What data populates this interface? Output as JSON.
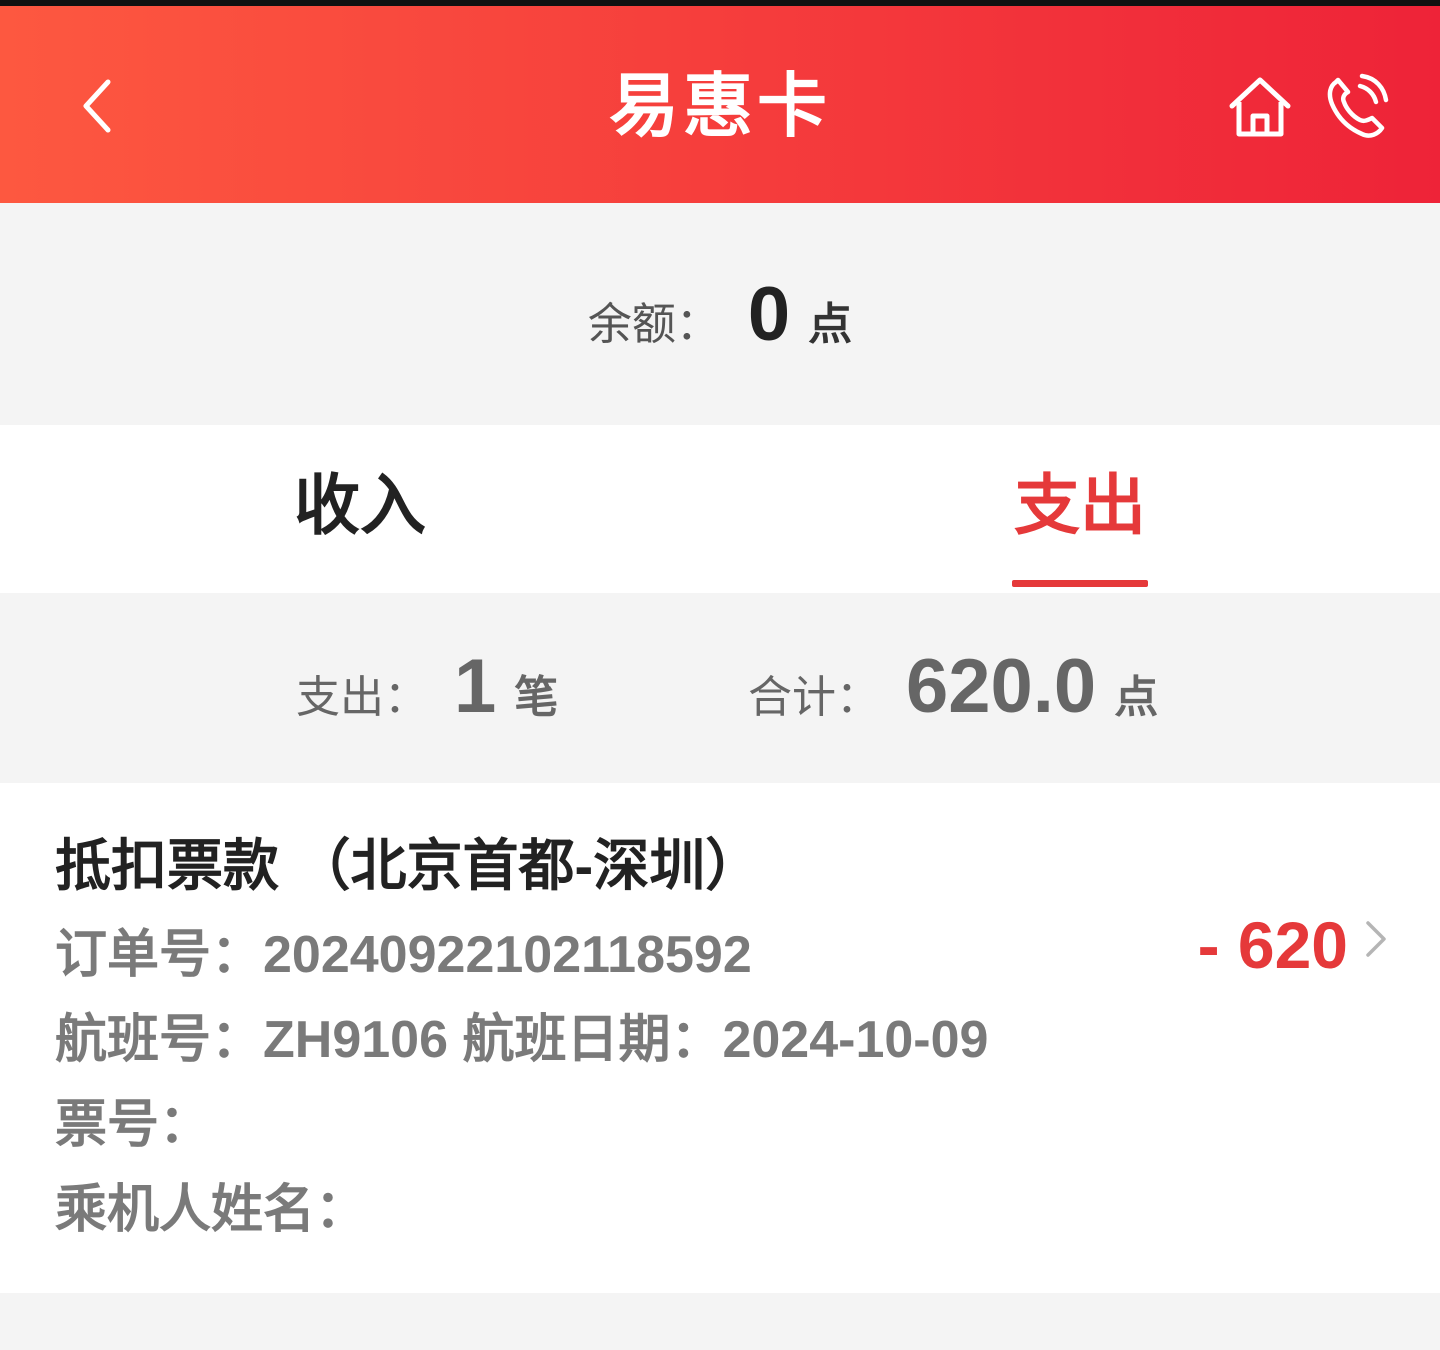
{
  "header": {
    "title": "易惠卡",
    "colors": {
      "gradient_start": "#fd5840",
      "gradient_end": "#ee2338"
    },
    "icons": [
      "chevron-left-icon",
      "home-icon",
      "phone-icon"
    ]
  },
  "balance": {
    "label": "余额：",
    "value": "0",
    "unit": "点"
  },
  "tabs": [
    {
      "label": "收入",
      "active": false
    },
    {
      "label": "支出",
      "active": true
    }
  ],
  "summary": {
    "count_label": "支出：",
    "count_value": "1",
    "count_unit": "笔",
    "total_label": "合计：",
    "total_value": "620.0",
    "total_unit": "点"
  },
  "records": [
    {
      "title": "抵扣票款 （北京首都-深圳）",
      "order_no": "订单号：20240922102118592",
      "flight": "航班号：ZH9106 航班日期：2024-10-09",
      "ticket_no": "票号：",
      "passenger": "乘机人姓名：",
      "amount": "- 620"
    }
  ],
  "accent_color": "#e5393a"
}
